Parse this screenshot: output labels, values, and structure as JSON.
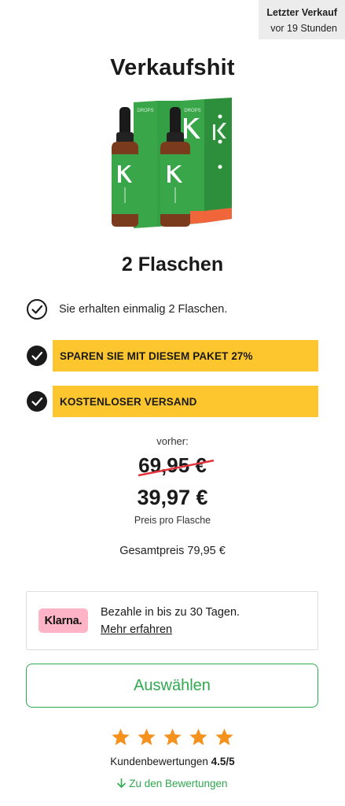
{
  "last_sale": {
    "label": "Letzter Verkauf",
    "time": "vor 19 Stunden"
  },
  "headline": "Verkaufshit",
  "product": {
    "image_icon": "product-bottles-image",
    "box_brand": "DROPS",
    "colors": {
      "box_green": "#3aa64a",
      "bottle_brown": "#7a3a1c",
      "box_orange": "#f0663a"
    }
  },
  "variant_title": "2 Flaschen",
  "features": {
    "plain": "Sie erhalten einmalig 2 Flaschen.",
    "savings": "SPAREN SIE MIT DIESEM PAKET 27%",
    "shipping": "KOSTENLOSER VERSAND"
  },
  "pricing": {
    "before_label": "vorher:",
    "old_price": "69,95 €",
    "new_price": "39,97 €",
    "per_bottle": "Preis pro Flasche",
    "total": "Gesamtpreis 79,95 €"
  },
  "klarna": {
    "logo": "Klarna.",
    "text": "Bezahle in bis zu 30 Tagen.",
    "link": "Mehr erfahren"
  },
  "select_button": "Auswählen",
  "rating": {
    "stars": 5,
    "label": "Kundenbewertungen",
    "score": "4.5/5"
  },
  "reviews_link": "Zu den Bewertungen",
  "colors": {
    "highlight_yellow": "#fdc62e",
    "accent_green": "#2fa84f",
    "star_orange": "#f5921e",
    "strike_red": "#e3343d",
    "klarna_pink": "#ffb3c7"
  }
}
